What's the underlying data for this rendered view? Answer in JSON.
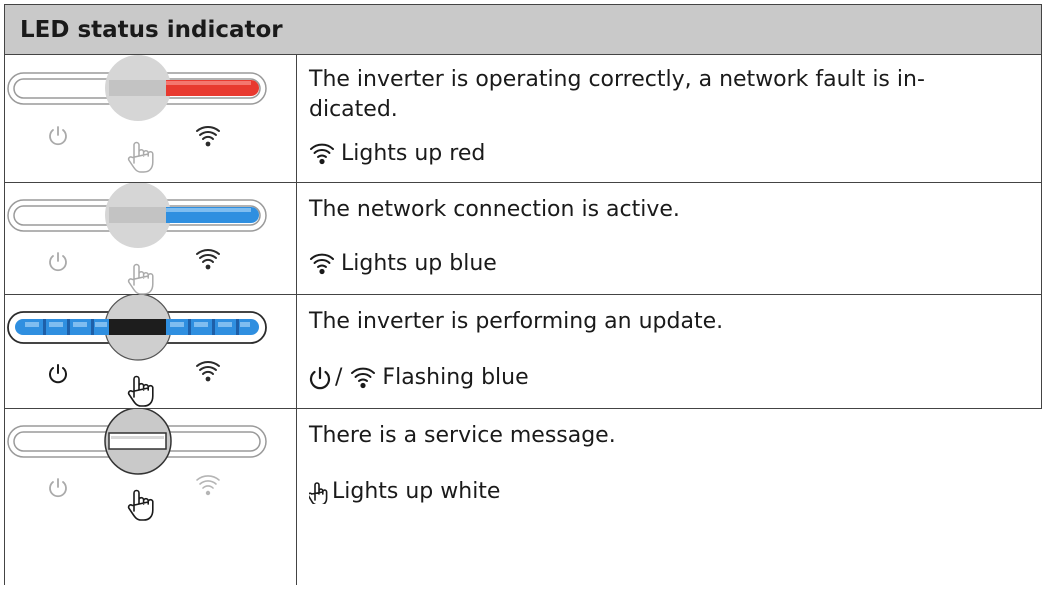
{
  "table": {
    "header": "LED status indicator",
    "rows": [
      {
        "description": "The inverter is operating correctly, a network fault is in-dicated.",
        "description_lines": [
          "The inverter is operating correctly, a network fault is in-",
          "dicated."
        ],
        "status_text": "Lights up red",
        "status_icons": [
          "wifi-icon"
        ],
        "led_color": "#e8392f",
        "led_segment": "right"
      },
      {
        "description": "The network connection is active.",
        "status_text": "Lights up blue",
        "status_icons": [
          "wifi-icon"
        ],
        "led_color": "#2f8fe0",
        "led_segment": "right"
      },
      {
        "description": "The inverter is performing an update.",
        "status_text": "Flashing blue",
        "status_separator": "/",
        "status_icons": [
          "power-icon",
          "wifi-icon"
        ],
        "led_color": "#2f8fe0",
        "led_segment": "all-flashing"
      },
      {
        "description": "There is a service message.",
        "status_text": "Lights up white",
        "status_icons": [
          "touch-icon"
        ],
        "led_color": "#ffffff",
        "led_segment": "center"
      }
    ]
  }
}
